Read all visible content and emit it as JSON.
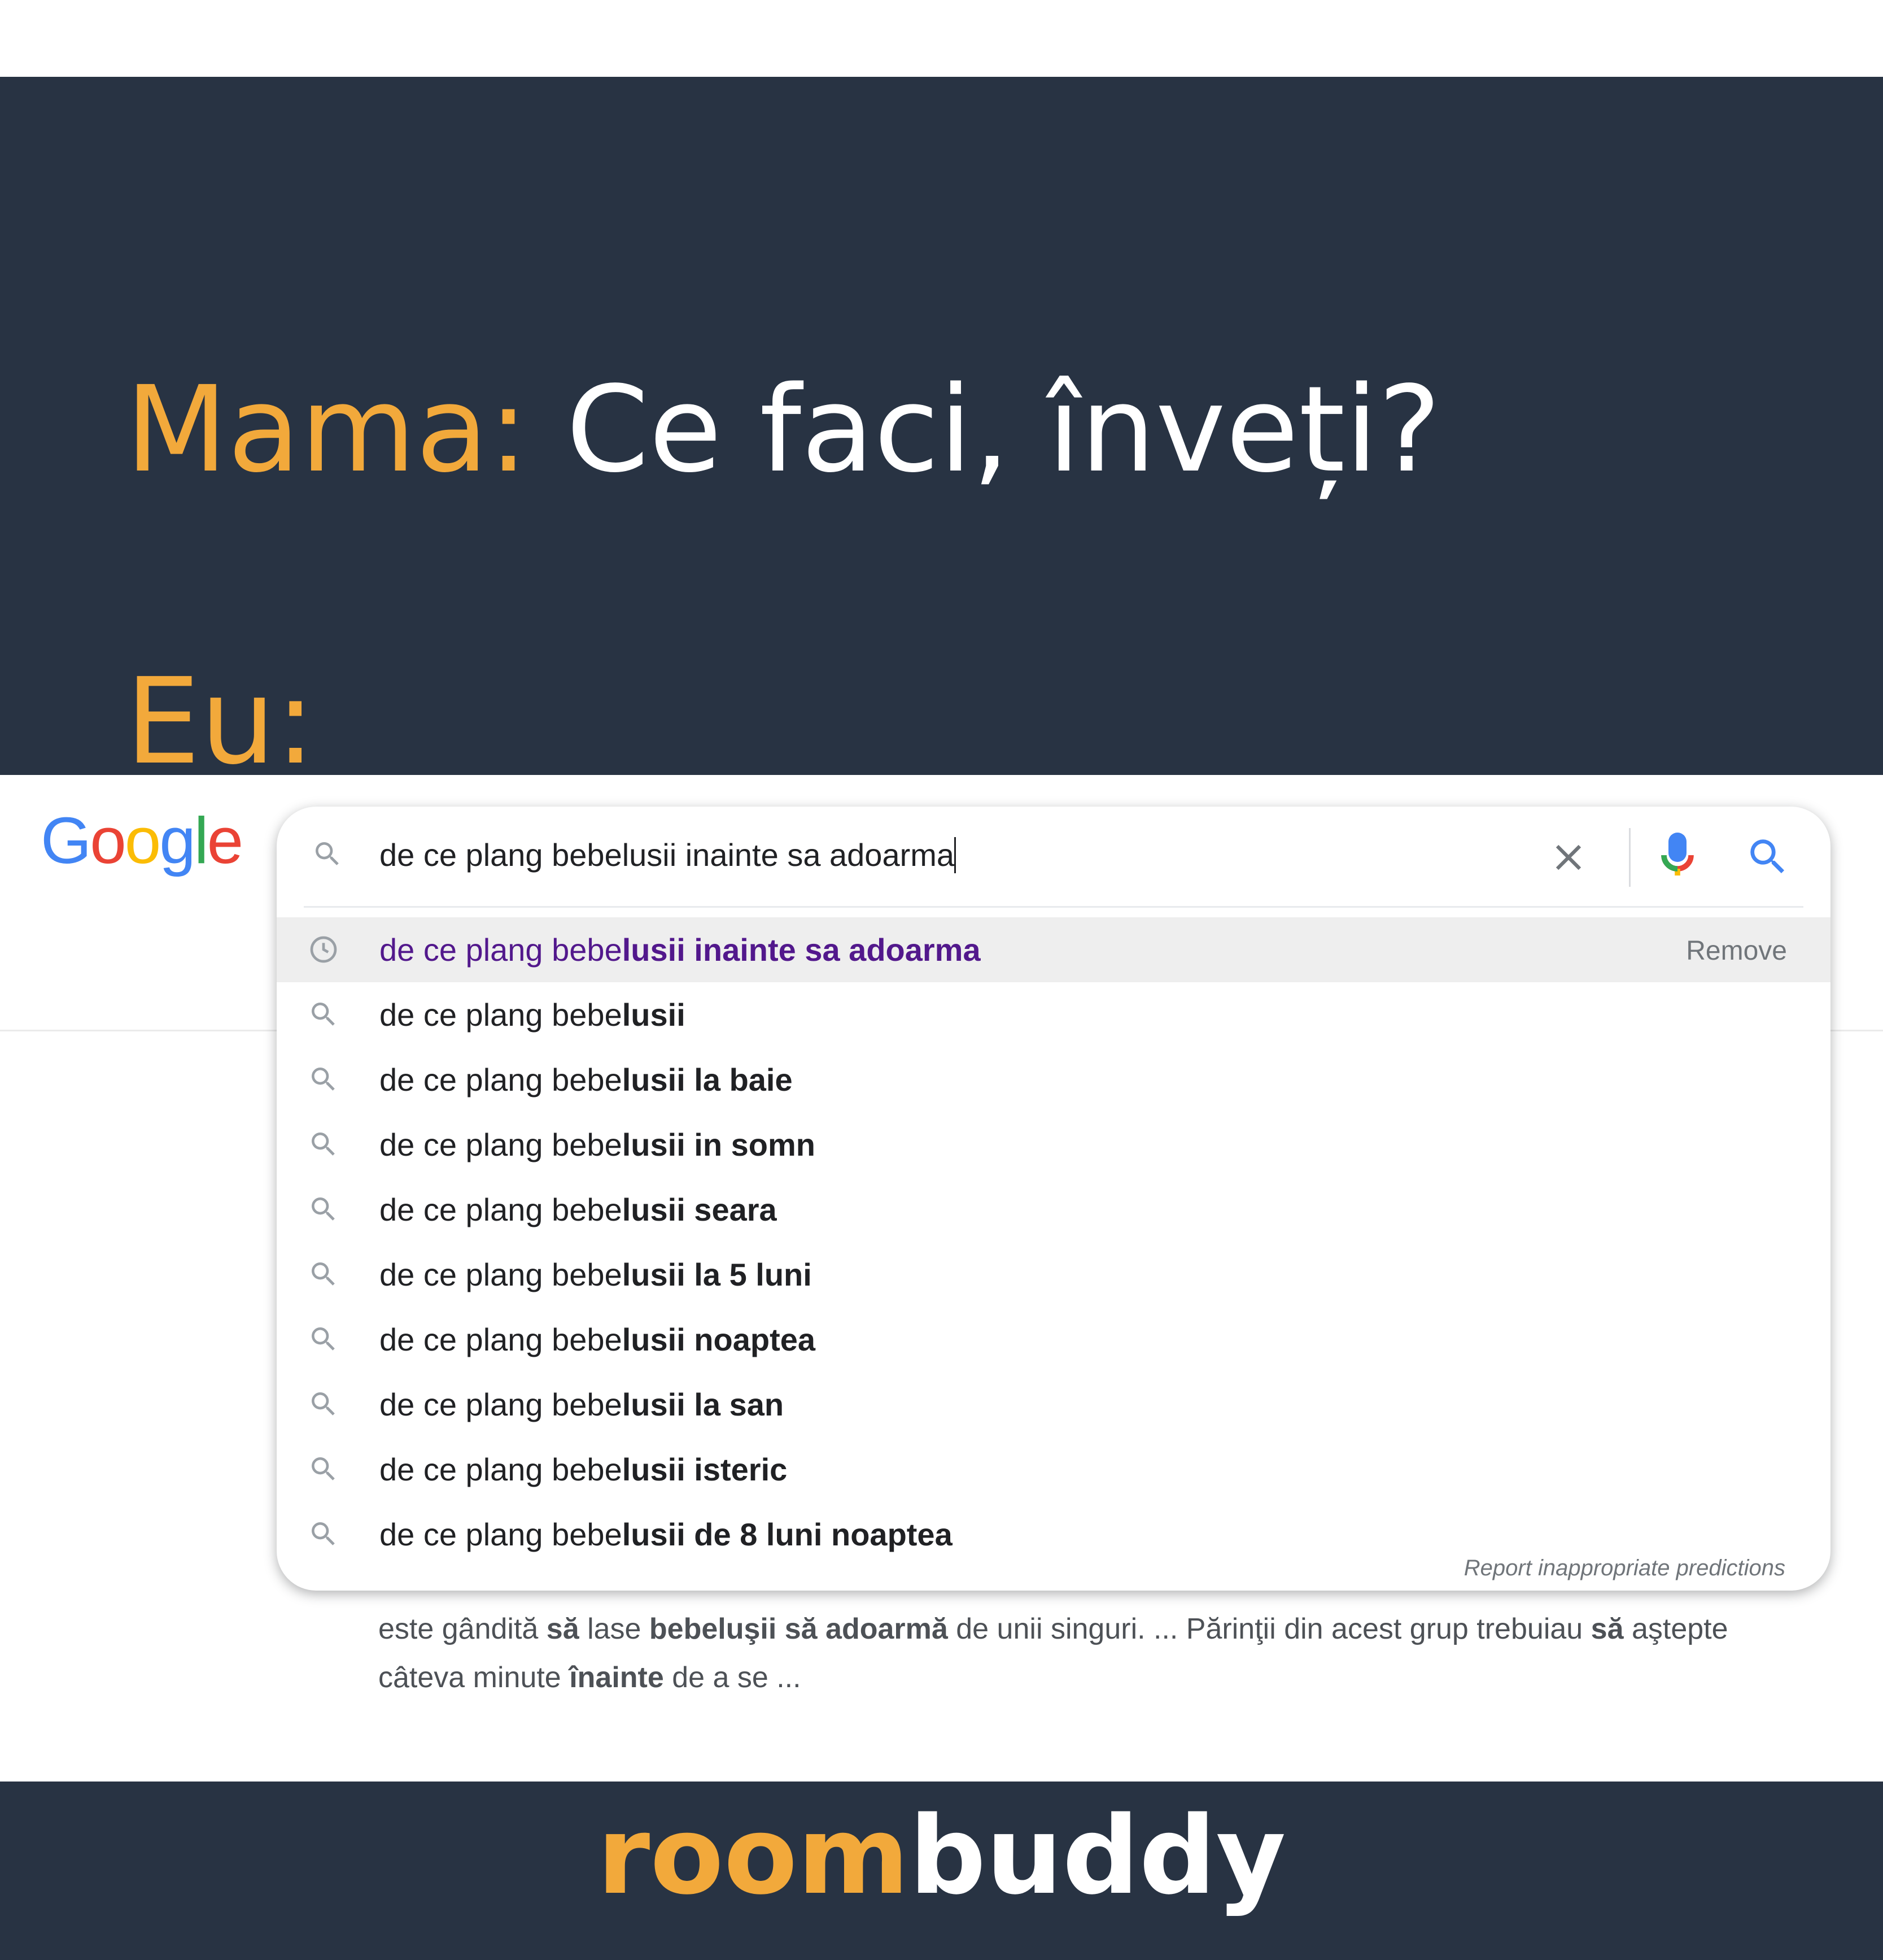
{
  "meme": {
    "line1": {
      "speaker": "Mama:",
      "text": "Ce faci, înveți?"
    },
    "line2": {
      "speaker": "Eu:"
    },
    "accent_color": "#f2a93b",
    "panel_color": "#283343"
  },
  "google": {
    "logo": {
      "text": [
        "G",
        "o",
        "o",
        "g",
        "l",
        "e"
      ],
      "colors": [
        "#4285f4",
        "#ea4335",
        "#fbbc05",
        "#4285f4",
        "#34a853",
        "#ea4335"
      ]
    },
    "search": {
      "query": "de ce plang bebelusii inainte sa adoarma",
      "icons": [
        "search-icon",
        "clear-icon",
        "microphone-icon",
        "search-submit-icon"
      ]
    },
    "suggestions": [
      {
        "type": "history",
        "icon": "history-clock-icon",
        "prefix": "de ce plang bebe",
        "bold": "lusii inainte sa adoarma",
        "action": "Remove"
      },
      {
        "type": "search",
        "icon": "search-icon",
        "prefix": "de ce plang bebe",
        "bold": "lusii"
      },
      {
        "type": "search",
        "icon": "search-icon",
        "prefix": "de ce plang bebe",
        "bold": "lusii la baie"
      },
      {
        "type": "search",
        "icon": "search-icon",
        "prefix": "de ce plang bebe",
        "bold": "lusii in somn"
      },
      {
        "type": "search",
        "icon": "search-icon",
        "prefix": "de ce plang bebe",
        "bold": "lusii seara"
      },
      {
        "type": "search",
        "icon": "search-icon",
        "prefix": "de ce plang bebe",
        "bold": "lusii la 5 luni"
      },
      {
        "type": "search",
        "icon": "search-icon",
        "prefix": "de ce plang bebe",
        "bold": "lusii noaptea"
      },
      {
        "type": "search",
        "icon": "search-icon",
        "prefix": "de ce plang bebe",
        "bold": "lusii la san"
      },
      {
        "type": "search",
        "icon": "search-icon",
        "prefix": "de ce plang bebe",
        "bold": "lusii isteric"
      },
      {
        "type": "search",
        "icon": "search-icon",
        "prefix": "de ce plang bebe",
        "bold": "lusii de 8 luni noaptea"
      }
    ],
    "report_link": "Report inappropriate predictions",
    "result_snippet": {
      "line1": [
        {
          "t": "este gândită ",
          "b": false
        },
        {
          "t": "să",
          "b": true
        },
        {
          "t": " lase ",
          "b": false
        },
        {
          "t": "bebeluşii să adoarmă",
          "b": true
        },
        {
          "t": " de unii singuri. ... Părinţii din acest grup trebuiau ",
          "b": false
        },
        {
          "t": "să",
          "b": true
        },
        {
          "t": " aştepte",
          "b": false
        }
      ],
      "line2": [
        {
          "t": "câteva minute ",
          "b": false
        },
        {
          "t": "înainte",
          "b": true
        },
        {
          "t": " de a se ...",
          "b": false
        }
      ]
    }
  },
  "footer": {
    "brand_part1": "room",
    "brand_part2": "buddy"
  }
}
